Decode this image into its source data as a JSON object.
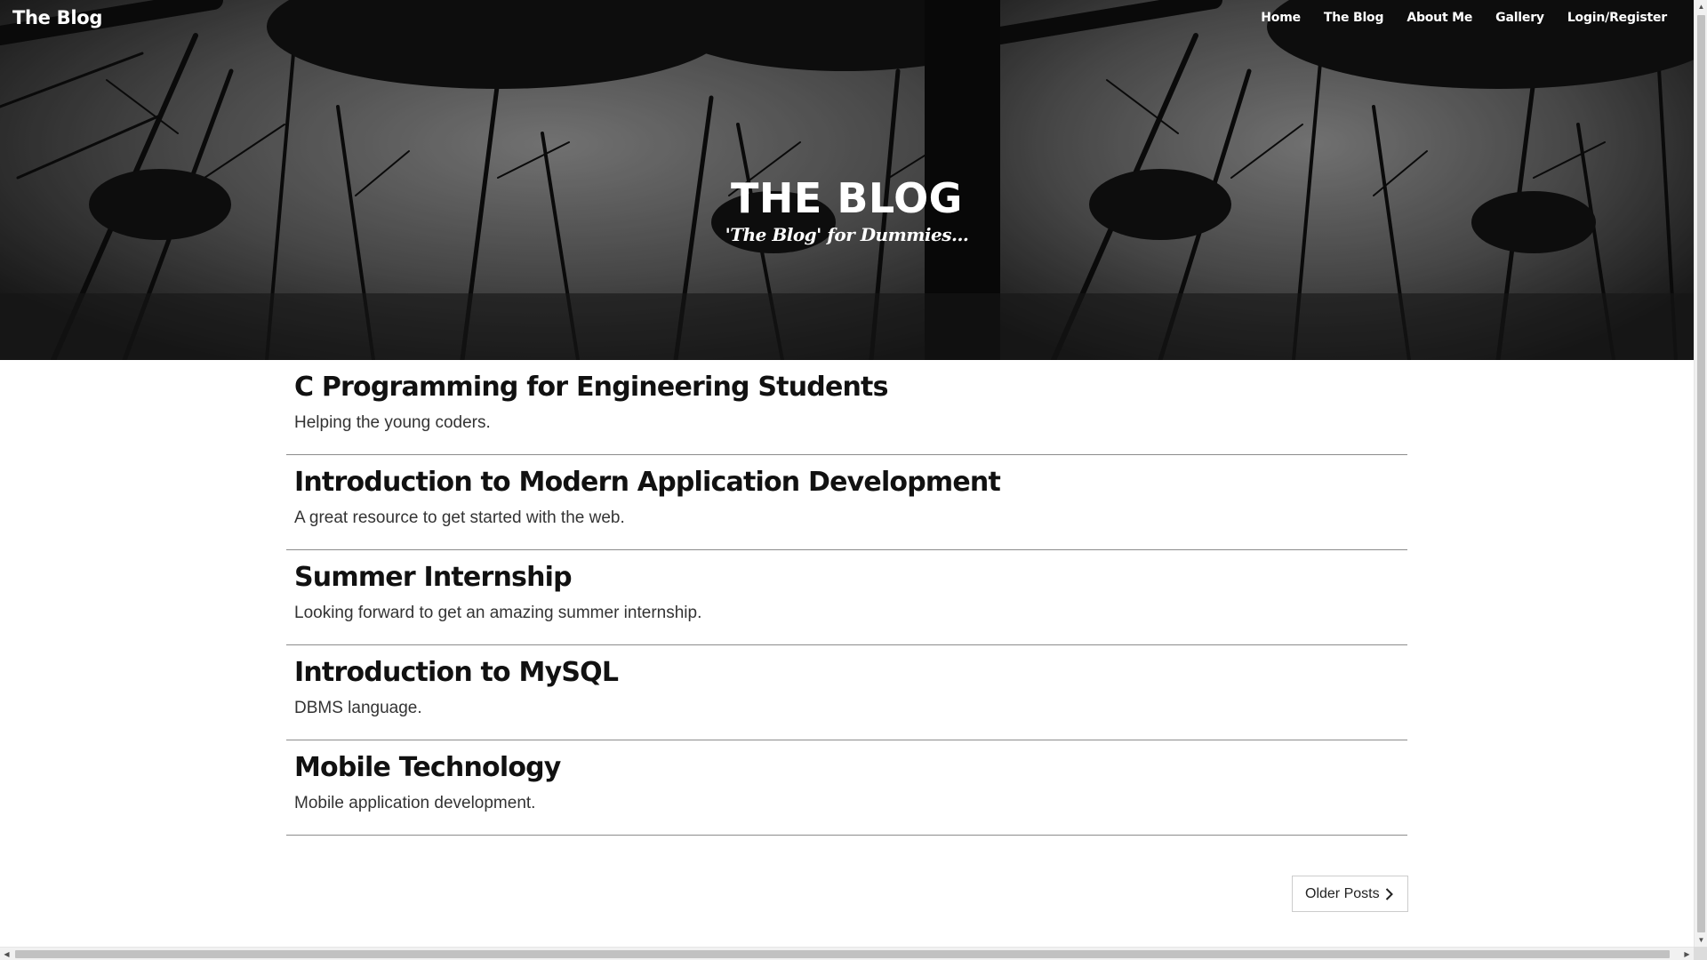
{
  "nav": {
    "brand": "The Blog",
    "links": [
      "Home",
      "The Blog",
      "About Me",
      "Gallery",
      "Login/Register"
    ]
  },
  "hero": {
    "title": "THE BLOG",
    "subtitle": "'The Blog' for Dummies..."
  },
  "posts": [
    {
      "title": "C Programming for Engineering Students",
      "subtitle": "Helping the young coders."
    },
    {
      "title": "Introduction to Modern Application Development",
      "subtitle": "A great resource to get started with the web."
    },
    {
      "title": "Summer Internship",
      "subtitle": "Looking forward to get an amazing summer internship."
    },
    {
      "title": "Introduction to MySQL",
      "subtitle": "DBMS language."
    },
    {
      "title": "Mobile Technology",
      "subtitle": "Mobile application development."
    }
  ],
  "pager": {
    "older_label": "Older Posts",
    "older_icon": "chevron-right-icon"
  },
  "colors": {
    "hero_bg": "#2a2a2a",
    "text": "#111111",
    "divider": "#8c8c8c"
  }
}
